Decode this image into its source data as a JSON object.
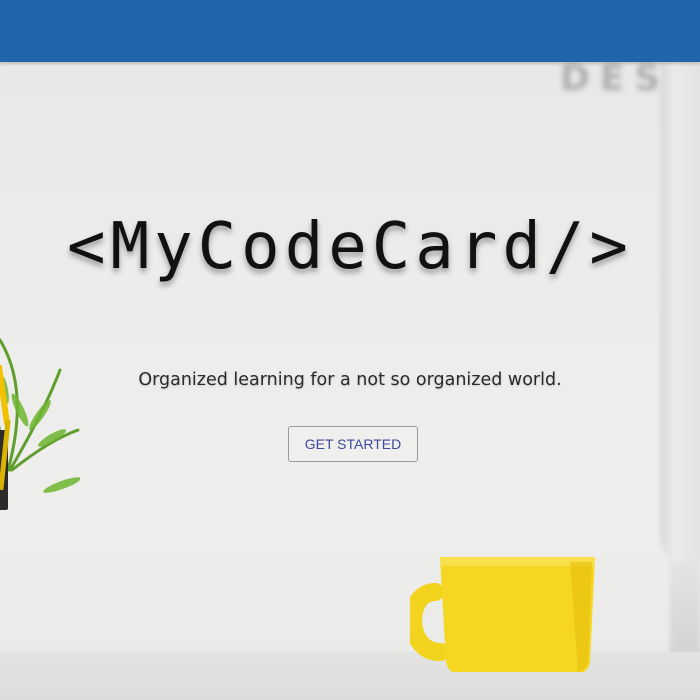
{
  "navbar": {
    "color": "#1f66ad"
  },
  "background": {
    "blurred_sign_text": "DES",
    "photo_elements": [
      "potted-plant",
      "yellow-mug",
      "monitor",
      "desk"
    ]
  },
  "hero": {
    "title": "<MyCodeCard/>",
    "tagline": "Organized learning for a not so organized world.",
    "cta_label": "GET STARTED",
    "cta_text_color": "#3d4a9e"
  }
}
